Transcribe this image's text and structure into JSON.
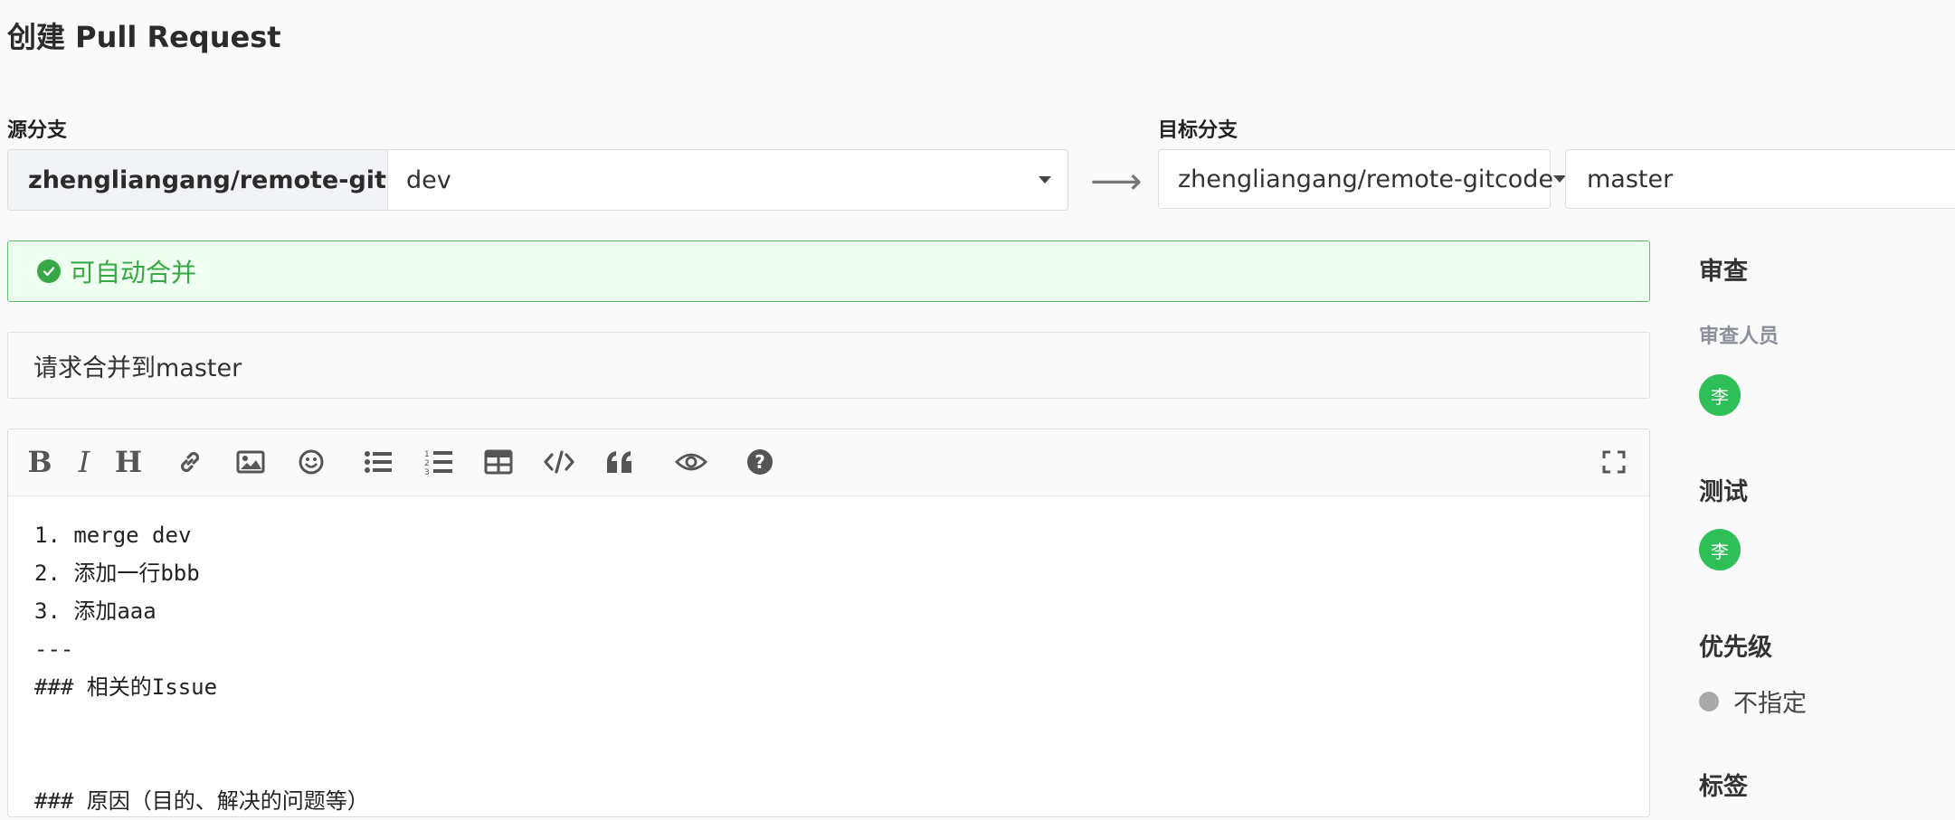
{
  "page": {
    "title": "创建 Pull Request"
  },
  "source": {
    "label": "源分支",
    "repo": "zhengliangang/remote-gitco...",
    "branch": "dev"
  },
  "arrow": "⟶",
  "target": {
    "label": "目标分支",
    "repo": "zhengliangang/remote-gitcode",
    "branch": "master"
  },
  "merge_status": {
    "text": "可自动合并",
    "color": "#36a845"
  },
  "title_field": {
    "value": "请求合并到master"
  },
  "toolbar": {
    "bold": "B",
    "italic": "I",
    "heading": "H",
    "icons": [
      "bold-icon",
      "italic-icon",
      "heading-icon",
      "link-icon",
      "image-icon",
      "emoji-icon",
      "bullet-list-icon",
      "numbered-list-icon",
      "table-icon",
      "code-icon",
      "quote-icon",
      "preview-icon",
      "help-icon",
      "fullscreen-icon"
    ]
  },
  "editor": {
    "lines": [
      "1. merge dev",
      "2. 添加一行bbb",
      "3. 添加aaa",
      "---",
      "### 相关的Issue",
      "",
      "",
      "### 原因（目的、解决的问题等）"
    ]
  },
  "sidebar": {
    "review": {
      "heading": "审查",
      "reviewers_label": "审查人员",
      "reviewer_avatar": "李"
    },
    "test": {
      "heading": "测试",
      "tester_avatar": "李"
    },
    "priority": {
      "heading": "优先级",
      "value": "不指定"
    },
    "labels": {
      "heading": "标签"
    }
  },
  "colors": {
    "avatar": "#2fbf59",
    "success_border": "#5cbf67",
    "success_bg": "#effff0"
  }
}
